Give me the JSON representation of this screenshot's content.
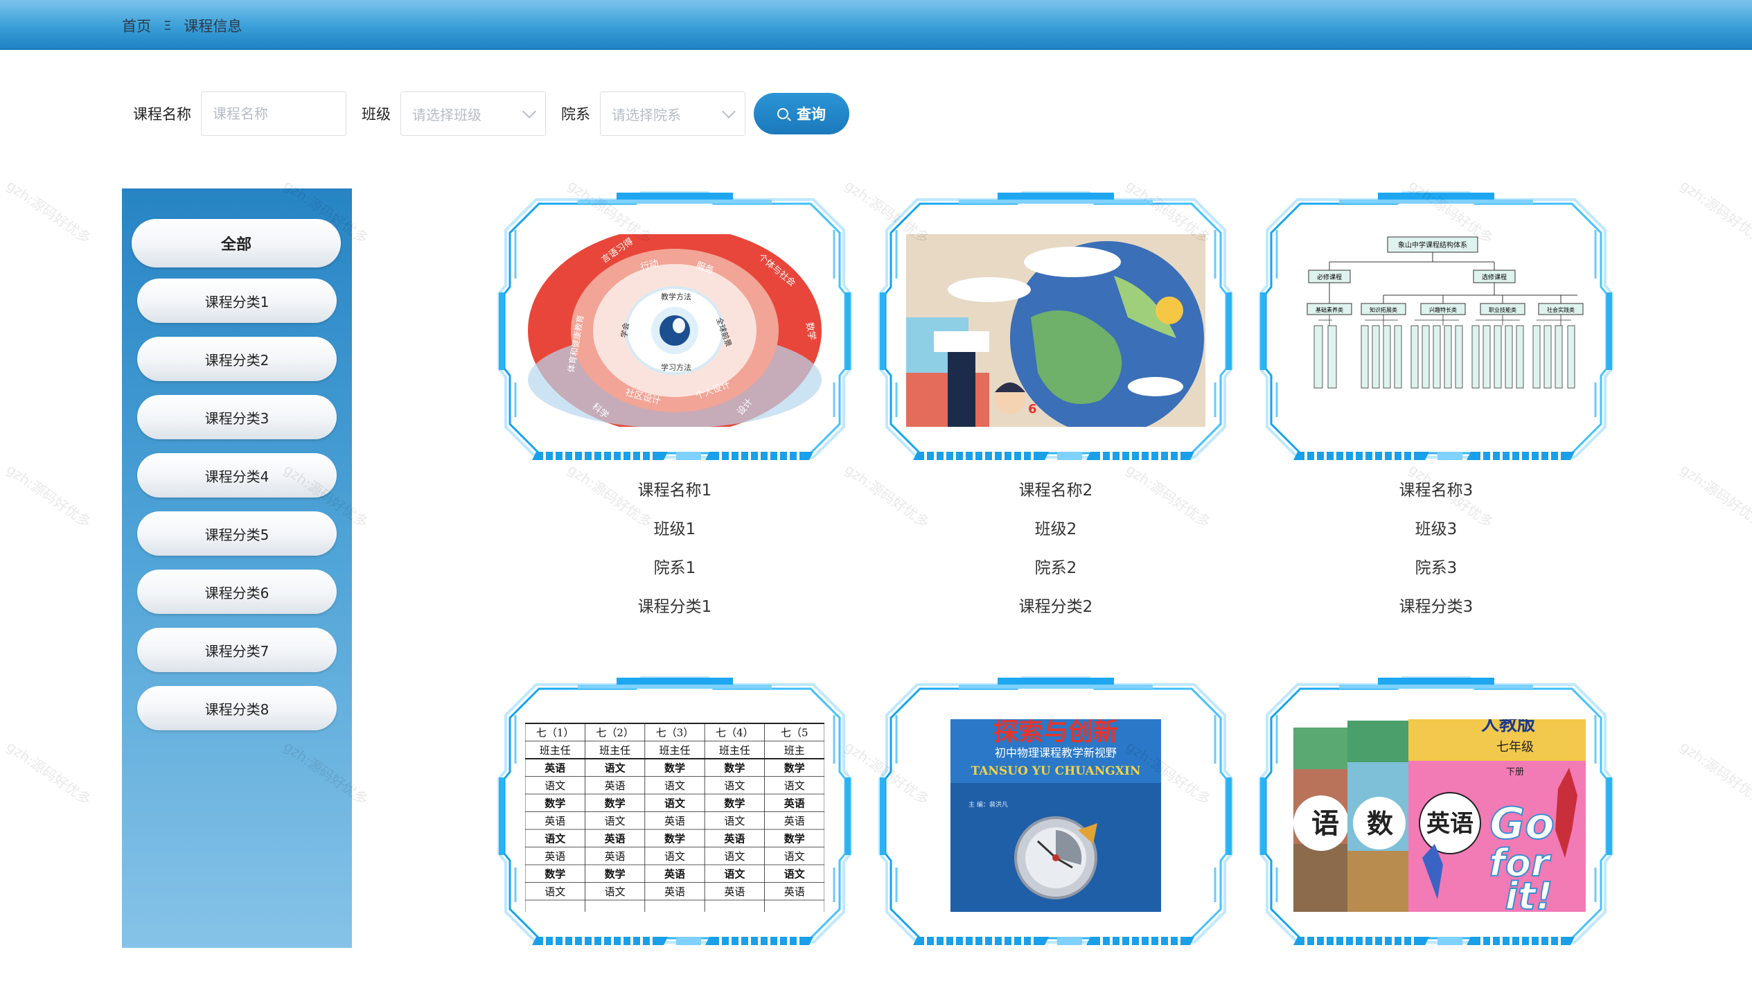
{
  "header": {
    "breadcrumb": [
      "首页",
      "课程信息"
    ],
    "separator": "Ξ"
  },
  "search": {
    "name_label": "课程名称",
    "name_placeholder": "课程名称",
    "class_label": "班级",
    "class_placeholder": "请选择班级",
    "dept_label": "院系",
    "dept_placeholder": "请选择院系",
    "query_label": "查询"
  },
  "sidebar": {
    "items": [
      {
        "label": "全部",
        "active": true
      },
      {
        "label": "课程分类1"
      },
      {
        "label": "课程分类2"
      },
      {
        "label": "课程分类3"
      },
      {
        "label": "课程分类4"
      },
      {
        "label": "课程分类5"
      },
      {
        "label": "课程分类6"
      },
      {
        "label": "课程分类7"
      },
      {
        "label": "课程分类8"
      }
    ]
  },
  "cards": [
    {
      "name": "课程名称1",
      "class": "班级1",
      "dept": "院系1",
      "category": "课程分类1"
    },
    {
      "name": "课程名称2",
      "class": "班级2",
      "dept": "院系2",
      "category": "课程分类2"
    },
    {
      "name": "课程名称3",
      "class": "班级3",
      "dept": "院系3",
      "category": "课程分类3"
    },
    {
      "name": "",
      "class": "",
      "dept": "",
      "category": ""
    },
    {
      "name": "",
      "class": "",
      "dept": "",
      "category": ""
    },
    {
      "name": "",
      "class": "",
      "dept": "",
      "category": ""
    }
  ],
  "thumbs": {
    "t1": {
      "top_left": "言语习得",
      "top": "行动",
      "top_right": "服务",
      "right_top": "个体与社会",
      "center_top": "教学方法",
      "center_left": "学会",
      "center_right": "全球前景",
      "center_bottom": "学习方法",
      "bottom_left": "社区设计",
      "bottom_right": "个人设计",
      "left": "体育和健康教育",
      "bottom_outer_left": "科学",
      "bottom_outer_right": "设计",
      "right": "数学"
    },
    "t3": {
      "root": "象山中学课程结构体系",
      "l1": [
        "必修课程",
        "选修课程"
      ],
      "l2": [
        "基础素养类",
        "知识拓展类",
        "兴趣特长类",
        "职业技能类",
        "社会实践类"
      ]
    },
    "t4": {
      "headers": [
        "七（1）",
        "七（2）",
        "七（3）",
        "七（4）",
        "七（5"
      ],
      "row0": [
        "班主任",
        "班主任",
        "班主任",
        "班主任",
        "班主"
      ],
      "rows": [
        [
          "英语",
          "语文",
          "数学",
          "数学",
          "数学"
        ],
        [
          "语文",
          "英语",
          "语文",
          "语文",
          "语文"
        ],
        [
          "数学",
          "数学",
          "语文",
          "数学",
          "英语"
        ],
        [
          "英语",
          "语文",
          "英语",
          "语文",
          "英语"
        ],
        [
          "语文",
          "英语",
          "数学",
          "英语",
          "数学"
        ],
        [
          "英语",
          "英语",
          "语文",
          "语文",
          "语文"
        ],
        [
          "数学",
          "数学",
          "英语",
          "语文",
          "语文"
        ],
        [
          "语文",
          "语文",
          "英语",
          "英语",
          "英语"
        ]
      ]
    },
    "t5": {
      "title": "探索与创新",
      "subtitle": "初中物理课程教学新视野",
      "pinyin": "TANSUO YU CHUANGXIN",
      "editor": "主 编：裴洪凡"
    },
    "t6": {
      "brand": "人教版",
      "grade": "七年级",
      "volume": "下册",
      "subj1": "语",
      "subj2": "数",
      "subj3": "英语",
      "slogan1": "Go",
      "slogan2": "for",
      "slogan3": "it!"
    }
  },
  "watermark": "gzh:源码好优多"
}
